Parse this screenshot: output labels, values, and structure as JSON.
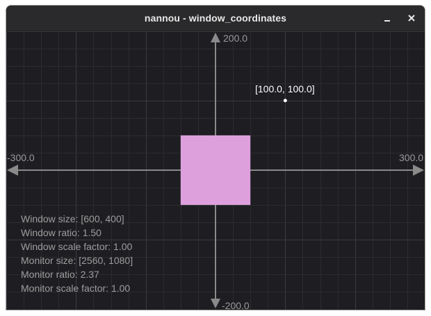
{
  "window": {
    "title": "nannou - window_coordinates",
    "minimize_glyph": "minimize-icon",
    "close_glyph": "close-icon"
  },
  "colors": {
    "background": "#1e1e22",
    "grid_minor": "#2b2b30",
    "grid_major": "#3a3a40",
    "axis": "#8a8a8a",
    "rect": "#dda0dd",
    "point": "#ffffff"
  },
  "axes": {
    "x_min_label": "-300.0",
    "x_max_label": "300.0",
    "y_max_label": "200.0",
    "y_min_label": "-200.0",
    "x_range": [
      -300,
      300
    ],
    "y_range": [
      -200,
      200
    ]
  },
  "point": {
    "x": 100,
    "y": 100,
    "label": "[100.0, 100.0]"
  },
  "rect": {
    "x": 0,
    "y": 0,
    "w": 100,
    "h": 100
  },
  "info": {
    "window_size": "Window size: [600, 400]",
    "window_ratio": "Window ratio: 1.50",
    "window_scale_factor": "Window scale factor: 1.00",
    "monitor_size": "Monitor size: [2560, 1080]",
    "monitor_ratio": "Monitor ratio: 2.37",
    "monitor_scale_factor": "Monitor scale factor: 1.00"
  }
}
